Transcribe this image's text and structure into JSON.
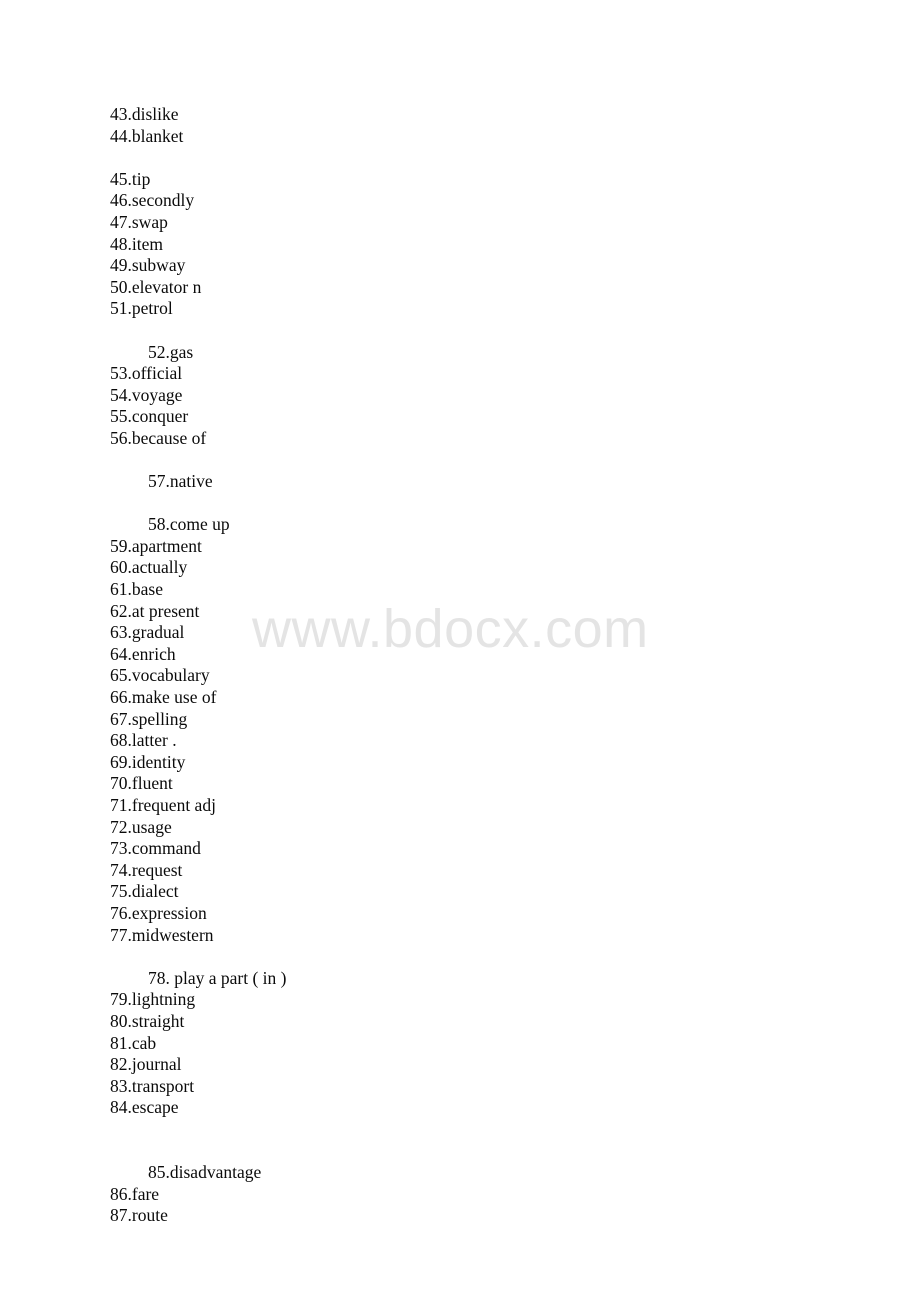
{
  "page": {
    "background_color": "#ffffff",
    "text_color": "#0b0b0b"
  },
  "watermark": {
    "text": "www.bdocx.com",
    "color": "#e4e4e4"
  },
  "document": {
    "lines": [
      {
        "type": "item",
        "text": "43.dislike",
        "indent": false
      },
      {
        "type": "item",
        "text": "44.blanket",
        "indent": false
      },
      {
        "type": "blank"
      },
      {
        "type": "item",
        "text": "45.tip",
        "indent": false
      },
      {
        "type": "item",
        "text": "46.secondly",
        "indent": false
      },
      {
        "type": "item",
        "text": "47.swap",
        "indent": false
      },
      {
        "type": "item",
        "text": "48.item",
        "indent": false
      },
      {
        "type": "item",
        "text": "49.subway",
        "indent": false
      },
      {
        "type": "item",
        "text": "50.elevator n",
        "indent": false
      },
      {
        "type": "item",
        "text": "51.petrol",
        "indent": false
      },
      {
        "type": "blank"
      },
      {
        "type": "item",
        "text": "52.gas",
        "indent": true
      },
      {
        "type": "item",
        "text": "53.official",
        "indent": false
      },
      {
        "type": "item",
        "text": "54.voyage",
        "indent": false
      },
      {
        "type": "item",
        "text": "55.conquer",
        "indent": false
      },
      {
        "type": "item",
        "text": "56.because of",
        "indent": false
      },
      {
        "type": "blank"
      },
      {
        "type": "item",
        "text": "57.native",
        "indent": true
      },
      {
        "type": "blank"
      },
      {
        "type": "item",
        "text": "58.come up",
        "indent": true
      },
      {
        "type": "item",
        "text": "59.apartment",
        "indent": false
      },
      {
        "type": "item",
        "text": "60.actually",
        "indent": false
      },
      {
        "type": "item",
        "text": "61.base",
        "indent": false
      },
      {
        "type": "item",
        "text": "62.at present",
        "indent": false
      },
      {
        "type": "item",
        "text": "63.gradual",
        "indent": false
      },
      {
        "type": "item",
        "text": "64.enrich",
        "indent": false
      },
      {
        "type": "item",
        "text": "65.vocabulary",
        "indent": false
      },
      {
        "type": "item",
        "text": "66.make use of",
        "indent": false
      },
      {
        "type": "item",
        "text": "67.spelling",
        "indent": false
      },
      {
        "type": "item",
        "text": "68.latter .",
        "indent": false
      },
      {
        "type": "item",
        "text": "69.identity",
        "indent": false
      },
      {
        "type": "item",
        "text": "70.fluent",
        "indent": false
      },
      {
        "type": "item",
        "text": "71.frequent adj",
        "indent": false
      },
      {
        "type": "item",
        "text": "72.usage",
        "indent": false
      },
      {
        "type": "item",
        "text": "73.command",
        "indent": false
      },
      {
        "type": "item",
        "text": "74.request",
        "indent": false
      },
      {
        "type": "item",
        "text": "75.dialect",
        "indent": false
      },
      {
        "type": "item",
        "text": "76.expression",
        "indent": false
      },
      {
        "type": "item",
        "text": "77.midwestern",
        "indent": false
      },
      {
        "type": "blank"
      },
      {
        "type": "item",
        "text": "78. play a part ( in )",
        "indent": true
      },
      {
        "type": "item",
        "text": "79.lightning",
        "indent": false
      },
      {
        "type": "item",
        "text": "80.straight",
        "indent": false
      },
      {
        "type": "item",
        "text": "81.cab",
        "indent": false
      },
      {
        "type": "item",
        "text": "82.journal",
        "indent": false
      },
      {
        "type": "item",
        "text": "83.transport",
        "indent": false
      },
      {
        "type": "item",
        "text": "84.escape",
        "indent": false
      },
      {
        "type": "blank2"
      },
      {
        "type": "item",
        "text": "85.disadvantage",
        "indent": true
      },
      {
        "type": "item",
        "text": "86.fare",
        "indent": false
      },
      {
        "type": "item",
        "text": "87.route",
        "indent": false
      }
    ]
  }
}
